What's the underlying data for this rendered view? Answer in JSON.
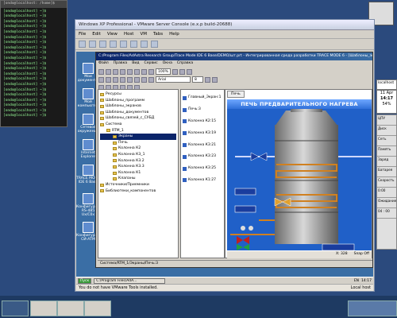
{
  "terminal": {
    "title": "[ondo@localhost: /home]$",
    "lines": [
      "[ondo@localhost] ~]$",
      "[ondo@localhost] ~]$",
      "[ondo@localhost] ~]$",
      "[ondo@localhost] ~]$",
      "[ondo@localhost] ~]$",
      "[ondo@localhost] ~]$",
      "[ondo@localhost] ~]$",
      "[ondo@localhost] ~]$",
      "[ondo@localhost] ~]$",
      "[ondo@localhost] ~]$",
      "[ondo@localhost] ~]$",
      "[ondo@localhost] ~]$",
      "[ondo@localhost] ~]$",
      "[ondo@localhost] ~]$",
      "[ondo@localhost] ~]$",
      "[ondo@localhost] ~]$",
      "[ondo@localhost] ~]$",
      "[ondo@localhost] ~]$",
      "[ondo@localhost] ~]$",
      "[ondo@localhost] ~]$",
      "[ondo@localhost] ~]$"
    ]
  },
  "vmware": {
    "title": "Windows XP Professional - VMware Server Console (e.x.p build-20688)",
    "menu": [
      "File",
      "Edit",
      "View",
      "Host",
      "VM",
      "Tabs",
      "Help"
    ],
    "status": "You do not have VMware Tools installed.",
    "host": "Local host"
  },
  "desktop": {
    "icons": [
      "Мои документы",
      "Мой компьютер",
      "Сетевое окружение",
      "Internet Explorer",
      "TRACE MODE IDE 6 Base",
      "Конфигуратор RS-485 Ux/C0x",
      "Конфигуратор СИ-АТМ"
    ]
  },
  "app": {
    "title": "C:/Program Files/AdAstra Research Group/Trace Mode IDE 6 Base/DEMO/шт.prt - Интегрированная среда разработки TRACE MODE 6 - [Шаблоны_экранов]",
    "menu": [
      "Файл",
      "Правка",
      "Вид",
      "Сервис",
      "Окна",
      "Справка"
    ],
    "zoom": "100%",
    "font": "Arial",
    "fontsize": "8"
  },
  "tree": {
    "items": [
      {
        "label": "Ресурсы",
        "indent": 0
      },
      {
        "label": "Шаблоны_программ",
        "indent": 0
      },
      {
        "label": "Шаблоны_экранов",
        "indent": 0
      },
      {
        "label": "Шаблоны_документов",
        "indent": 0
      },
      {
        "label": "Шаблоны_связей_с_СУБД",
        "indent": 0
      },
      {
        "label": "Система",
        "indent": 0
      },
      {
        "label": "RTM_1",
        "indent": 1
      },
      {
        "label": "Экраны",
        "indent": 2,
        "selected": true
      },
      {
        "label": "Печь",
        "indent": 2
      },
      {
        "label": "Колонна К2",
        "indent": 2
      },
      {
        "label": "Колонна К3_1",
        "indent": 2
      },
      {
        "label": "Колонна К3.2",
        "indent": 2
      },
      {
        "label": "Колонна К3.3",
        "indent": 2
      },
      {
        "label": "Колонна К1",
        "indent": 2
      },
      {
        "label": "Клапаны",
        "indent": 2
      },
      {
        "label": "Источники/Приемники",
        "indent": 0
      },
      {
        "label": "Библиотеки_компонентов",
        "indent": 0
      }
    ],
    "status": "Система/RTM_1/Экраны/Печь:3"
  },
  "screens": {
    "items": [
      "Главный_Экран:1",
      "Печь:3",
      "Колонна К2:15",
      "Колонна К3:19",
      "Колонна К3:21",
      "Колонна К3:23",
      "Колонна К3:25",
      "Колонна К1:27"
    ]
  },
  "drawing": {
    "tab": "Печь",
    "title": "ПЕЧЬ ПРЕДВАРИТЕЛЬНОГО НАГРЕВА",
    "status_left": "X: 328",
    "status_right": "Snap Off"
  },
  "guest_taskbar": {
    "start": "Пуск",
    "window": "C:/Program Files/AdA...",
    "time": "14:17",
    "lang": "EN"
  },
  "monitor": {
    "cells": [
      "localhost",
      "11 Apr",
      "14:17",
      "ЦПУ",
      "Диск",
      "Сеть",
      "Память",
      "Заряд",
      "Батарея",
      "Скорость",
      "0:00",
      "Ожидание",
      "04 : 00"
    ]
  },
  "clock": {
    "date": "11 Apr",
    "time": "14:17",
    "pct": "54%"
  }
}
